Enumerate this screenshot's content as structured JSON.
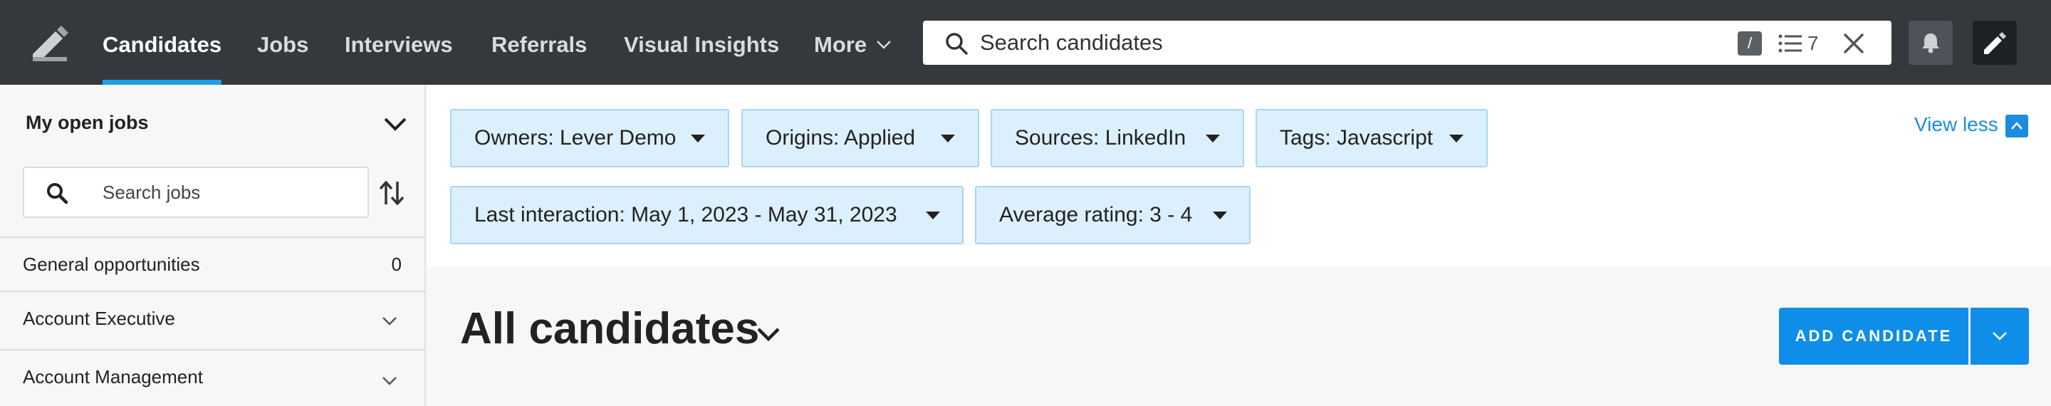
{
  "nav": {
    "items": [
      {
        "label": "Candidates"
      },
      {
        "label": "Jobs"
      },
      {
        "label": "Interviews"
      },
      {
        "label": "Referrals"
      },
      {
        "label": "Visual Insights"
      },
      {
        "label": "More"
      }
    ],
    "active": "Candidates",
    "search": {
      "placeholder": "Search candidates",
      "shortcut": "/",
      "filter_count": "7"
    },
    "icons": [
      "lever-logo-icon",
      "search-icon",
      "list-icon",
      "close-icon",
      "bell-icon",
      "profile-icon"
    ]
  },
  "sidebar": {
    "title": "My open jobs",
    "search_placeholder": "Search jobs",
    "rows": [
      {
        "label": "General opportunities",
        "count": "0"
      },
      {
        "label": "Account Executive"
      },
      {
        "label": "Account Management"
      }
    ]
  },
  "filters": {
    "chips": [
      {
        "label": "Owners: Lever Demo"
      },
      {
        "label": "Origins: Applied"
      },
      {
        "label": "Sources: LinkedIn"
      },
      {
        "label": "Tags: Javascript"
      },
      {
        "label": "Last interaction: May 1, 2023 - May 31, 2023"
      },
      {
        "label": "Average rating: 3 - 4"
      }
    ],
    "toggle_label": "View less"
  },
  "main": {
    "title": "All candidates",
    "add_button": "ADD CANDIDATE"
  },
  "colors": {
    "nav_bg": "#35393d",
    "accent": "#0e8ee9",
    "chip_bg": "#dbeffc",
    "chip_border": "#a9d6f5"
  }
}
